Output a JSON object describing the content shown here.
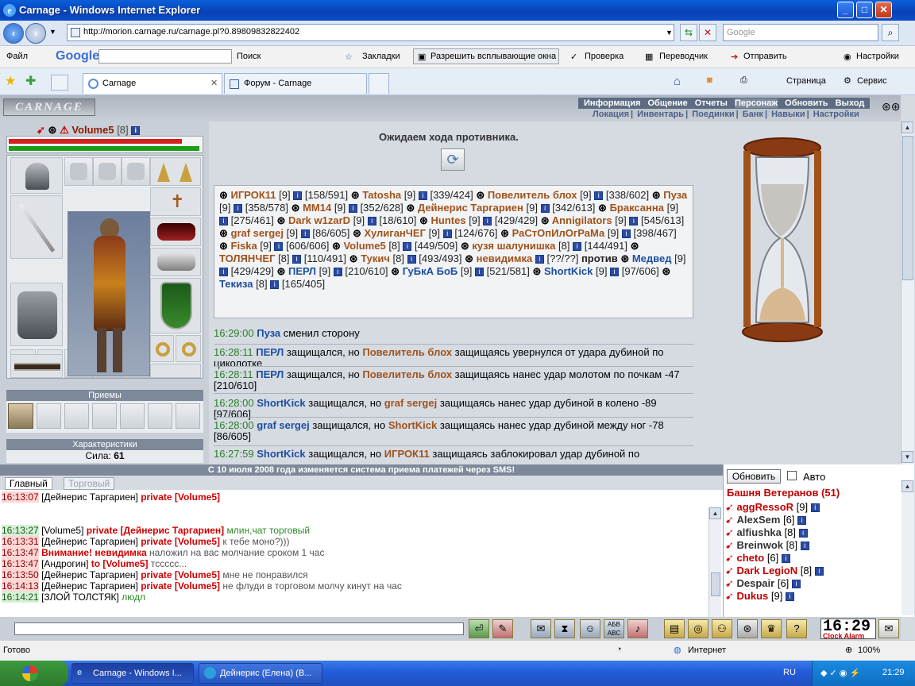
{
  "window": {
    "title": "Carnage - Windows Internet Explorer"
  },
  "address": {
    "url": "http://morion.carnage.ru/carnage.pl?0.89809832822402",
    "search_placeholder": "Google"
  },
  "toolbar": {
    "file": "Файл",
    "google": "Google",
    "search": "Поиск",
    "bookmarks": "Закладки",
    "popups": "Разрешить всплывающие окна",
    "check": "Проверка",
    "translate": "Переводчик",
    "send": "Отправить",
    "settings": "Настройки"
  },
  "tabs": [
    {
      "label": "Carnage"
    },
    {
      "label": "Форум - Carnage"
    }
  ],
  "ie_cmd": {
    "page": "Страница",
    "service": "Сервис"
  },
  "game": {
    "logo": "CARNAGE",
    "nav_main": [
      "Информация",
      "Общение",
      "Отчеты",
      "Персонаж",
      "Обновить",
      "Выход"
    ],
    "nav_sub": [
      "Локация",
      "Инвентарь",
      "Поединки",
      "Банк",
      "Навыки",
      "Настройки"
    ],
    "player": {
      "name": "Volume5",
      "level": "[8]"
    },
    "sections": {
      "skills": "Приемы",
      "stats": "Характеристики",
      "strength": "Сила:",
      "strength_val": "61"
    },
    "wait_text": "Ожидаем хода противника.",
    "vs": "против",
    "team_a": [
      {
        "name": "ИГРОК11",
        "lvl": "[9]",
        "hp": "[158/591]"
      },
      {
        "name": "Tatosha",
        "lvl": "[9]",
        "hp": "[339/424]"
      },
      {
        "name": "Повелитель блох",
        "lvl": "[9]",
        "hp": "[338/602]"
      },
      {
        "name": "Пуза",
        "lvl": "[9]",
        "hp": "[358/578]"
      },
      {
        "name": "MM14",
        "lvl": "[9]",
        "hp": "[352/628]"
      },
      {
        "name": "Дейнерис Таргариен",
        "lvl": "[9]",
        "hp": "[342/613]"
      },
      {
        "name": "Браксанна",
        "lvl": "[9]",
        "hp": "[275/461]"
      },
      {
        "name": "Dark w1zarD",
        "lvl": "[9]",
        "hp": "[18/610]"
      },
      {
        "name": "Huntes",
        "lvl": "[9]",
        "hp": "[429/429]"
      },
      {
        "name": "Annigilators",
        "lvl": "[9]",
        "hp": "[545/613]"
      },
      {
        "name": "graf sergej",
        "lvl": "[9]",
        "hp": "[86/605]"
      },
      {
        "name": "ХулиганЧЕГ",
        "lvl": "[9]",
        "hp": "[124/676]"
      },
      {
        "name": "РаСтОпИлОгРаМа",
        "lvl": "[9]",
        "hp": "[398/467]"
      },
      {
        "name": "Fiska",
        "lvl": "[9]",
        "hp": "[606/606]"
      },
      {
        "name": "Volume5",
        "lvl": "[8]",
        "hp": "[449/509]"
      },
      {
        "name": "кузя шалунишка",
        "lvl": "[8]",
        "hp": "[144/491]"
      },
      {
        "name": "ТОЛЯНЧЕГ",
        "lvl": "[8]",
        "hp": "[110/491]"
      },
      {
        "name": "Тукич",
        "lvl": "[8]",
        "hp": "[493/493]"
      },
      {
        "name": "невидимка",
        "lvl": "",
        "hp": "[??/??]"
      }
    ],
    "team_b": [
      {
        "name": "Медвед",
        "lvl": "[9]",
        "hp": "[429/429]"
      },
      {
        "name": "ПЕРЛ",
        "lvl": "[9]",
        "hp": "[210/610]"
      },
      {
        "name": "ГуБкА БоБ",
        "lvl": "[9]",
        "hp": "[521/581]"
      },
      {
        "name": "ShortKick",
        "lvl": "[9]",
        "hp": "[97/606]"
      },
      {
        "name": "Текиза",
        "lvl": "[8]",
        "hp": "[165/405]"
      }
    ],
    "log": [
      {
        "time": "16:29:00",
        "a": "Пуза",
        "text": "сменил сторону"
      },
      {
        "time": "16:28:11",
        "a": "ПЕРЛ",
        "mid": "защищался, но",
        "b": "Повелитель блох",
        "text": "защищаясь увернулся от удара дубиной по циколотке"
      },
      {
        "time": "16:28:11",
        "a": "ПЕРЛ",
        "mid": "защищался, но",
        "b": "Повелитель блох",
        "text": "защищаясь нанес удар молотом по почкам -47 [210/610]"
      },
      {
        "time": "16:28:00",
        "a": "ShortKick",
        "mid": "защищался, но",
        "b": "graf sergej",
        "text": "защищаясь нанес удар дубиной в колено -89 [97/606]"
      },
      {
        "time": "16:28:00",
        "a": "graf sergej",
        "mid": "защищался, но",
        "b": "ShortKick",
        "text": "защищаясь нанес удар дубиной между ног -78 [86/605]"
      },
      {
        "time": "16:27:59",
        "a": "ShortKick",
        "mid": "защищался, но",
        "b": "ИГРОК11",
        "text": "защищаясь заблокировал удар дубиной по"
      }
    ],
    "banner": "С 10 июля 2008 года изменяется система приема платежей через SMS!",
    "chat_tabs": [
      "Главный",
      "Торговый"
    ],
    "chat": [
      {
        "time": "16:13:07",
        "name": "[Дейнерис Таргариен]",
        "private": "private [Volume5]",
        "msg": ""
      },
      {
        "time": "16:13:27",
        "name": "[Volume5]",
        "private": "private [Дейнерис Таргариен]",
        "msg": "млин,чат торговый"
      },
      {
        "time": "16:13:31",
        "name": "[Дейнерис Таргариен]",
        "private": "private [Volume5]",
        "msg": "к тебе моно?)))"
      },
      {
        "time": "16:13:47",
        "name": "Внимание!",
        "private": "невидимка",
        "msg": "наложил на вас молчание сроком 1 час"
      },
      {
        "time": "16:13:47",
        "name": "[Андрогин]",
        "private": "to [Volume5]",
        "msg": "тсcccc..."
      },
      {
        "time": "16:13:50",
        "name": "[Дейнерис Таргариен]",
        "private": "private [Volume5]",
        "msg": "мне не понравился"
      },
      {
        "time": "16:14:13",
        "name": "[Дейнерис Таргариен]",
        "private": "private [Volume5]",
        "msg": "не флуди в торговом молчу кинут на час"
      },
      {
        "time": "16:14:21",
        "name": "[ЗЛОЙ ТОЛСТЯК]",
        "private": "",
        "msg": "людл"
      }
    ],
    "room": {
      "update": "Обновить",
      "auto": "Авто",
      "title": "Башня Ветеранов (51)",
      "players": [
        {
          "name": "aggRessoR",
          "lvl": "[9]"
        },
        {
          "name": "AlexSem",
          "lvl": "[6]"
        },
        {
          "name": "alfiushka",
          "lvl": "[8]"
        },
        {
          "name": "Breinwok",
          "lvl": "[8]"
        },
        {
          "name": "cheto",
          "lvl": "[6]"
        },
        {
          "name": "Dark LegioN",
          "lvl": "[8]"
        },
        {
          "name": "Despair",
          "lvl": "[6]"
        },
        {
          "name": "Dukus",
          "lvl": "[9]"
        }
      ]
    },
    "clock": {
      "time": "16:29",
      "label": "Clock Alarm"
    }
  },
  "status": {
    "ready": "Готово",
    "zone": "Интернет",
    "zoom": "100%"
  },
  "taskbar": {
    "items": [
      "Carnage - Windows I...",
      "Дейнерис (Елена) (В..."
    ],
    "lang": "RU",
    "time": "21:29"
  }
}
